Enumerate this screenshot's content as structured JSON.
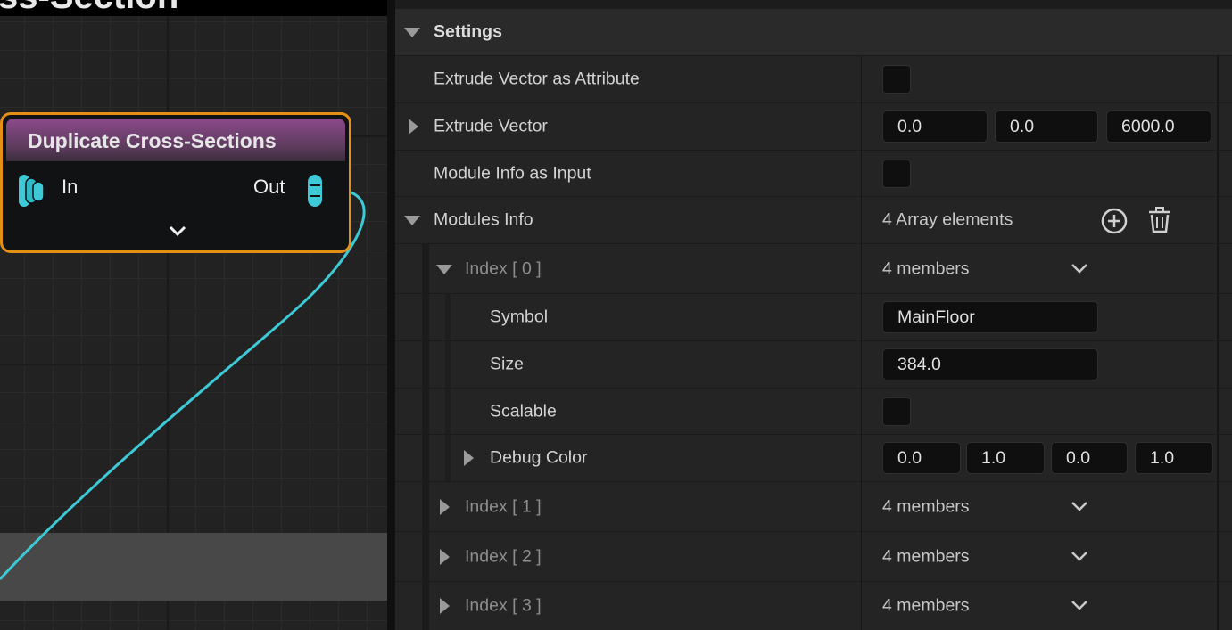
{
  "graph": {
    "title": "ss-Section",
    "node": {
      "title": "Duplicate Cross-Sections",
      "in_label": "In",
      "out_label": "Out"
    },
    "colors": {
      "node_border": "#e58f15",
      "wire": "#3ec9d6",
      "node_header": "#8c4a8c"
    }
  },
  "details": {
    "section": "Settings",
    "extrude_vector_as_attribute": {
      "label": "Extrude Vector as Attribute",
      "checked": false
    },
    "extrude_vector": {
      "label": "Extrude Vector",
      "x": "0.0",
      "y": "0.0",
      "z": "6000.0"
    },
    "module_info_as_input": {
      "label": "Module Info as Input",
      "checked": false
    },
    "modules_info": {
      "label": "Modules Info",
      "count_text": "4 Array elements",
      "add_icon": "plus-circle-icon",
      "delete_icon": "trash-icon"
    },
    "indices": [
      {
        "label": "Index",
        "index": "0",
        "members": "4 members"
      },
      {
        "label": "Index",
        "index": "1",
        "members": "4 members"
      },
      {
        "label": "Index",
        "index": "2",
        "members": "4 members"
      },
      {
        "label": "Index",
        "index": "3",
        "members": "4 members"
      }
    ],
    "index0_fields": {
      "symbol": {
        "label": "Symbol",
        "value": "MainFloor"
      },
      "size": {
        "label": "Size",
        "value": "384.0"
      },
      "scalable": {
        "label": "Scalable",
        "checked": false
      },
      "debug_color": {
        "label": "Debug Color",
        "r": "0.0",
        "g": "1.0",
        "b": "0.0",
        "a": "1.0"
      }
    }
  }
}
